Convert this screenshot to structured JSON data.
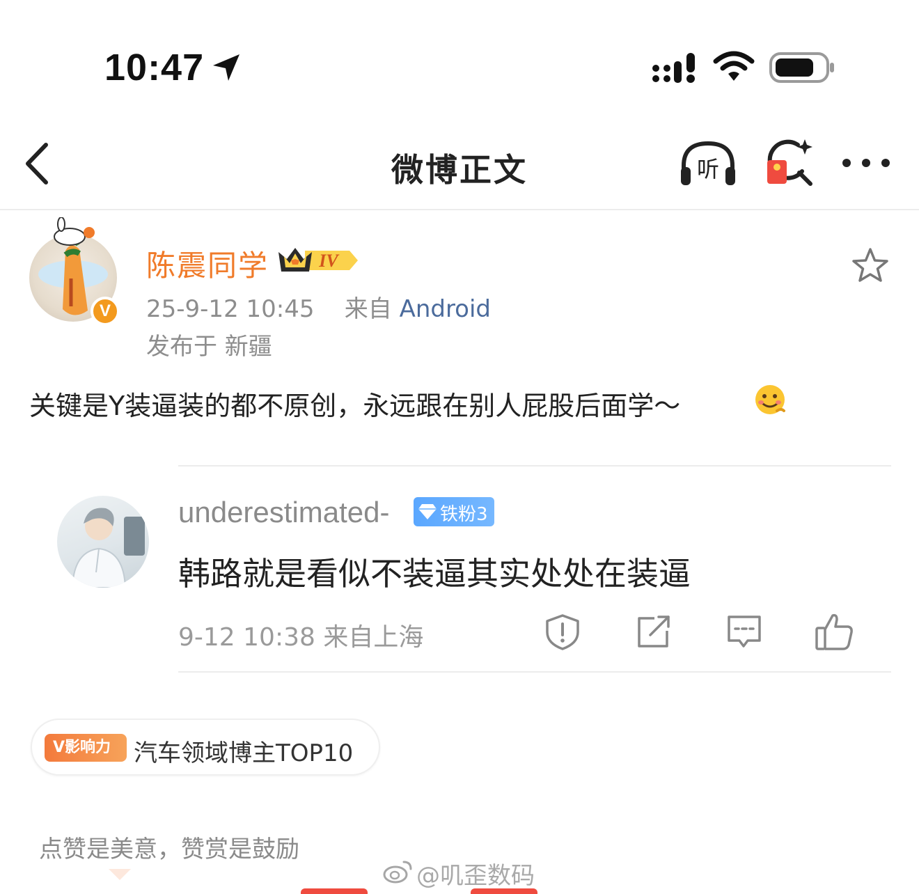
{
  "status_bar": {
    "time": "10:47"
  },
  "nav": {
    "title": "微博正文",
    "listen_label": "听"
  },
  "post": {
    "author_name": "陈震同学",
    "vip_level": "IV",
    "verified_mark": "V",
    "timestamp": "25-9-12 10:45",
    "source_prefix": "来自",
    "source": "Android",
    "location": "发布于 新疆",
    "text": "关键是Y装逼装的都不原创，永远跟在别人屁股后面学～"
  },
  "quoted_comment": {
    "username": "underestimated-",
    "fan_badge": "铁粉3",
    "text": "韩路就是看似不装逼其实处处在装逼",
    "meta": "9-12 10:38 来自上海"
  },
  "influence": {
    "badge": "V影响力",
    "label": "汽车领域博主TOP10"
  },
  "reward": {
    "text": "点赞是美意，赞赏是鼓励"
  },
  "watermark": {
    "text": "@叽歪数码"
  },
  "colors": {
    "author_orange": "#f07b2a",
    "source_blue": "#4b6b9c",
    "fan_badge_blue": "#5aa7ff",
    "influence_orange": "#f37a3c",
    "gift_red": "#ef4b3f"
  },
  "icons": [
    "location-arrow-icon",
    "cellular-signal-icon",
    "wifi-icon",
    "battery-icon",
    "back-chevron-icon",
    "headphones-listen-icon",
    "search-redpacket-icon",
    "more-dots-icon",
    "star-icon",
    "smiling-emoji-icon",
    "diamond-icon",
    "report-icon",
    "share-icon",
    "reply-icon",
    "thumbs-up-icon",
    "weibo-logo-icon"
  ]
}
